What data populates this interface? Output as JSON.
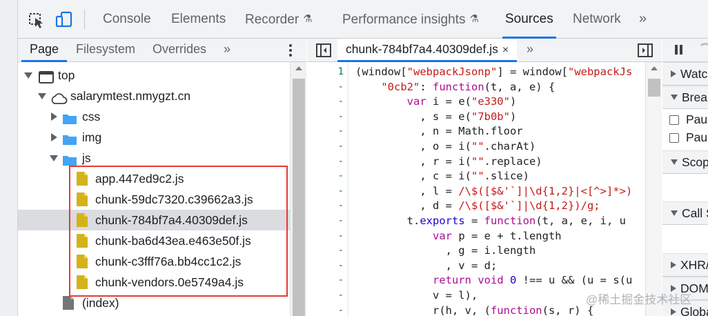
{
  "toolbar": {
    "tabs": [
      {
        "label": "Console",
        "active": false,
        "experimental": false
      },
      {
        "label": "Elements",
        "active": false,
        "experimental": false
      },
      {
        "label": "Recorder",
        "active": false,
        "experimental": true
      },
      {
        "label": "Performance insights",
        "active": false,
        "experimental": true
      },
      {
        "label": "Sources",
        "active": true,
        "experimental": false
      },
      {
        "label": "Network",
        "active": false,
        "experimental": false
      }
    ],
    "more_label": "»",
    "flask_glyph": "⚗",
    "accent_color": "#1a73e8"
  },
  "navigator": {
    "tabs": [
      {
        "label": "Page",
        "active": true
      },
      {
        "label": "Filesystem",
        "active": false
      },
      {
        "label": "Overrides",
        "active": false
      }
    ],
    "more_label": "»",
    "tree": [
      {
        "label": "top",
        "type": "frame",
        "expanded": true,
        "depth": 0
      },
      {
        "label": "salarymtest.nmygzt.cn",
        "type": "domain",
        "expanded": true,
        "depth": 1
      },
      {
        "label": "css",
        "type": "folder",
        "expanded": false,
        "depth": 2
      },
      {
        "label": "img",
        "type": "folder",
        "expanded": false,
        "depth": 2
      },
      {
        "label": "js",
        "type": "folder",
        "expanded": true,
        "depth": 2
      },
      {
        "label": "app.447ed9c2.js",
        "type": "js-file",
        "depth": 3
      },
      {
        "label": "chunk-59dc7320.c39662a3.js",
        "type": "js-file",
        "depth": 3
      },
      {
        "label": "chunk-784bf7a4.40309def.js",
        "type": "js-file",
        "depth": 3,
        "selected": true
      },
      {
        "label": "chunk-ba6d43ea.e463e50f.js",
        "type": "js-file",
        "depth": 3
      },
      {
        "label": "chunk-c3fff76a.bb4cc1c2.js",
        "type": "js-file",
        "depth": 3
      },
      {
        "label": "chunk-vendors.0e5749a4.js",
        "type": "js-file",
        "depth": 3
      },
      {
        "label": "(index)",
        "type": "doc-file",
        "depth": 2
      }
    ]
  },
  "editor": {
    "file_tab": "chunk-784bf7a4.40309def.js",
    "close_glyph": "×",
    "more_label": "»",
    "line_numbers": [
      "1",
      "-",
      "-",
      "-",
      "-",
      "-",
      "-",
      "-",
      "-",
      "-",
      "-",
      "-",
      "-",
      "-",
      "-",
      "-",
      "-",
      "-",
      "-"
    ],
    "code_lines": [
      "(window[\"webpackJsonp\"] = window[\"webpackJs",
      "    \"0cb2\": function(t, a, e) {",
      "        var i = e(\"e330\")",
      "          , s = e(\"7b0b\")",
      "          , n = Math.floor",
      "          , o = i(\"\".charAt)",
      "          , r = i(\"\".replace)",
      "          , c = i(\"\".slice)",
      "          , l = /\\$([$&'`]|\\d{1,2}|<[^>]*>)",
      "          , d = /\\$([$&'`]|\\d{1,2})/g;",
      "        t.exports = function(t, a, e, i, u",
      "            var p = e + t.length",
      "              , g = i.length",
      "              , v = d;",
      "            return void 0 !== u && (u = s(u",
      "            v = l),",
      "            r(h, v, (function(s, r) {"
    ]
  },
  "debugger": {
    "sections": [
      {
        "label": "Watch",
        "expanded": false
      },
      {
        "label": "Breakpoints",
        "expanded": true
      },
      {
        "label": "Scope",
        "expanded": true
      },
      {
        "label": "Call Stack",
        "expanded": true
      },
      {
        "label": "XHR/fetch Breakpoints",
        "expanded": false
      },
      {
        "label": "DOM Breakpoints",
        "expanded": false
      },
      {
        "label": "Global Listeners",
        "expanded": false
      }
    ],
    "breakpoint_options": [
      {
        "label": "Pause on uncaught exceptions",
        "checked": false
      },
      {
        "label": "Pause on caught exceptions",
        "checked": false
      }
    ]
  },
  "watermark": {
    "text": "@稀土掘金技术社区"
  },
  "annotation": {
    "color": "#e53935"
  }
}
